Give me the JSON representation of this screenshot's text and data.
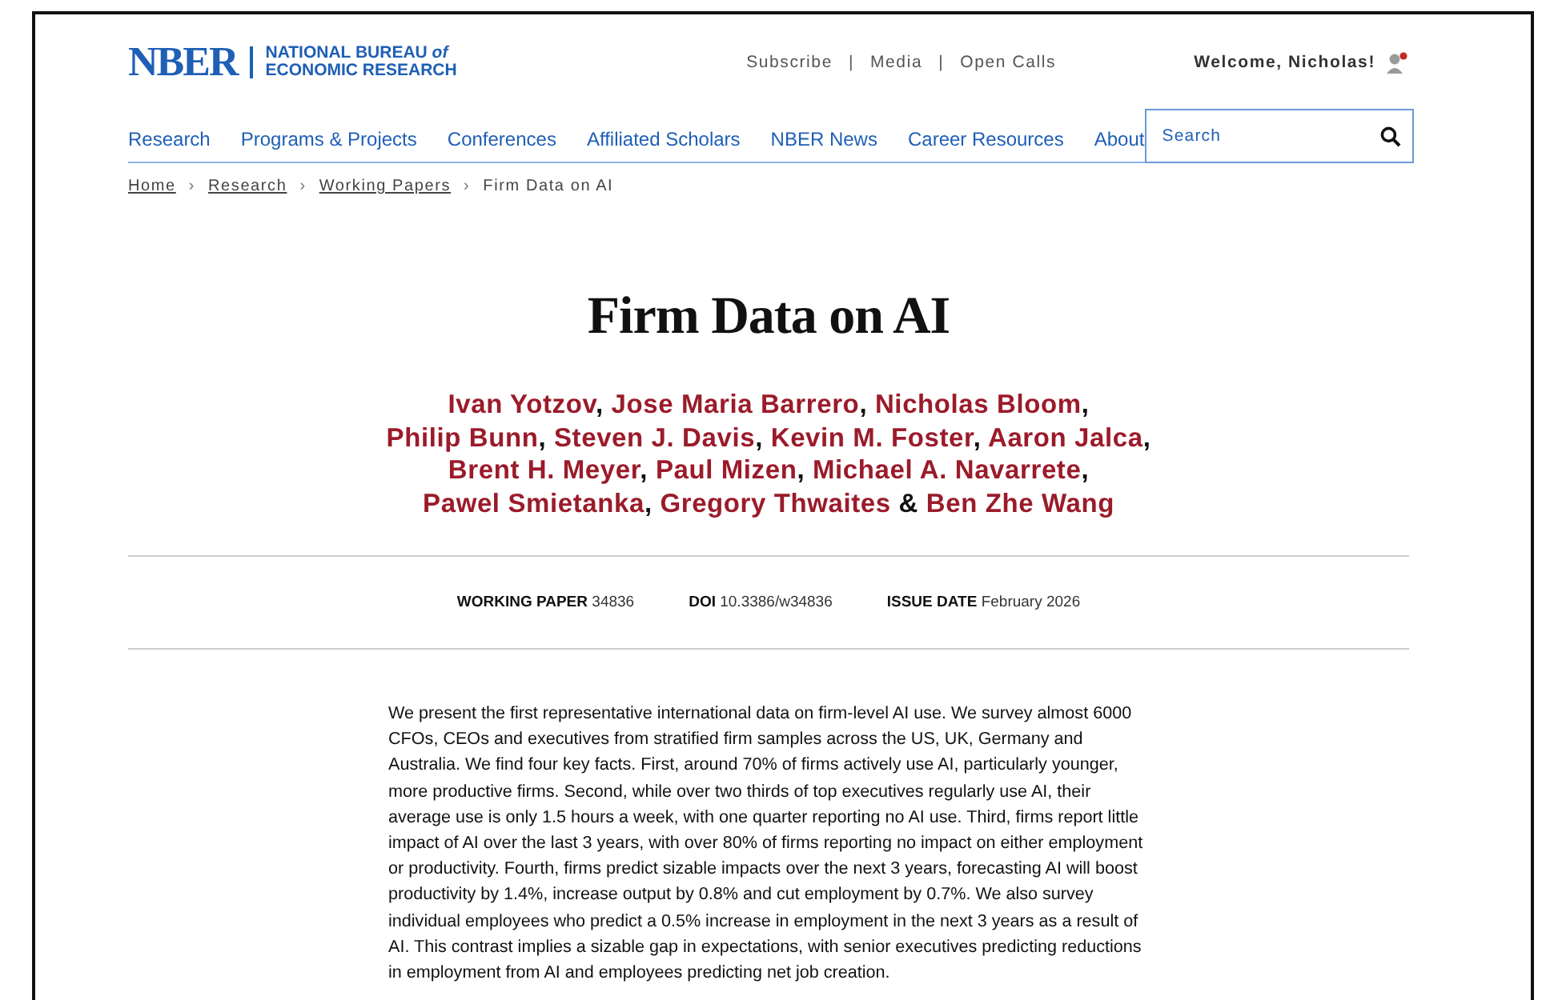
{
  "logo": {
    "mark": "NBER",
    "name": "NATIONAL BUREAU *of*",
    "name_line2": "ECONOMIC RESEARCH"
  },
  "top_links": [
    "Subscribe",
    "Media",
    "Open Calls"
  ],
  "top_link_separator": "|",
  "breadcrumb_separator": "›",
  "welcome": "Welcome, Nicholas!",
  "nav": [
    "Research",
    "Programs & Projects",
    "Conferences",
    "Affiliated Scholars",
    "NBER News",
    "Career Resources",
    "About"
  ],
  "search": {
    "placeholder": "Search"
  },
  "breadcrumb": [
    {
      "label": "Home",
      "link": true
    },
    {
      "label": "Research",
      "link": true
    },
    {
      "label": "Working Papers",
      "link": true
    },
    {
      "label": "Firm Data on AI",
      "link": false
    }
  ],
  "title": "Firm Data on AI",
  "authors": [
    {
      "name": "Ivan Yotzov",
      "after": ","
    },
    {
      "name": "Jose Maria Barrero",
      "after": ","
    },
    {
      "name": "Nicholas Bloom",
      "after": ","
    },
    {
      "name": "Philip Bunn",
      "after": ","
    },
    {
      "name": "Steven J. Davis",
      "after": ","
    },
    {
      "name": "Kevin M. Foster",
      "after": ","
    },
    {
      "name": "Aaron Jalca",
      "after": ","
    },
    {
      "name": "Brent H. Meyer",
      "after": ","
    },
    {
      "name": "Paul Mizen",
      "after": ","
    },
    {
      "name": "Michael A. Navarrete",
      "after": ","
    },
    {
      "name": "Pawel Smietanka",
      "after": ","
    },
    {
      "name": "Gregory Thwaites",
      "after": "&"
    },
    {
      "name": "Ben Zhe Wang"
    }
  ],
  "meta": [
    {
      "label": "WORKING PAPER",
      "value": "34836"
    },
    {
      "label": "DOI",
      "value": "10.3386/w34836"
    },
    {
      "label": "ISSUE DATE",
      "value": "February 2026"
    }
  ],
  "abstract": "We present the first representative international data on firm-level AI use. We survey almost 6000 CFOs, CEOs and executives from stratified firm samples across the US, UK, Germany and Australia. We find four key facts. First, around 70% of firms actively use AI, particularly younger, more productive firms. Second, while over two thirds of top executives regularly use AI, their average use is only 1.5 hours a week, with one quarter reporting no AI use. Third, firms report little impact of AI over the last 3 years, with over 80% of firms reporting no impact on either employment or productivity. Fourth, firms predict sizable impacts over the next 3 years, forecasting AI will boost productivity by 1.4%, increase output by 0.8% and cut employment by 0.7%. We also survey individual employees who predict a 0.5% increase in employment in the next 3 years as a result of AI. This contrast implies a sizable gap in expectations, with senior executives predicting reductions in employment from AI and employees predicting net job creation."
}
